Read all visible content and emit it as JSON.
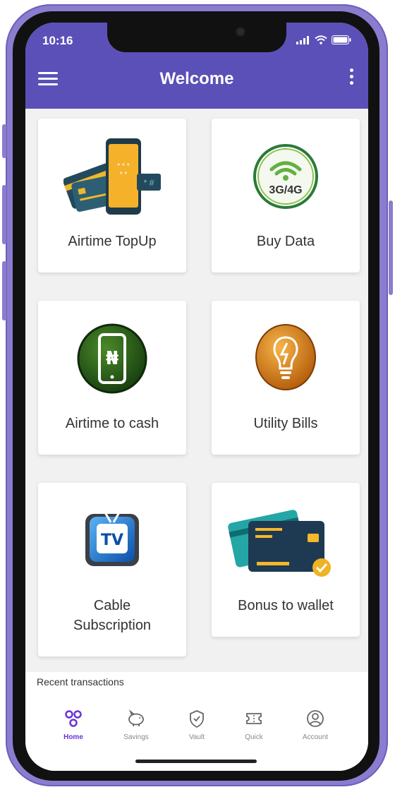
{
  "status_bar": {
    "time": "10:16"
  },
  "app_bar": {
    "title": "Welcome"
  },
  "tiles": [
    {
      "label": "Airtime TopUp",
      "icon": "airtime-topup-icon"
    },
    {
      "label": "Buy Data",
      "icon": "data-3g4g-icon",
      "badge": "3G/4G"
    },
    {
      "label": "Airtime to cash",
      "icon": "naira-phone-icon",
      "symbol": "₦"
    },
    {
      "label": "Utility Bills",
      "icon": "lightbulb-icon"
    },
    {
      "label": "Cable Subscription",
      "icon": "tv-icon",
      "badge": "TV"
    },
    {
      "label": "Bonus to wallet",
      "icon": "cards-icon"
    }
  ],
  "recent": {
    "label": "Recent transactions"
  },
  "bottom_nav": [
    {
      "label": "Home",
      "icon": "home-bubbles-icon",
      "active": true
    },
    {
      "label": "Savings",
      "icon": "piggy-bank-icon",
      "active": false
    },
    {
      "label": "Vault",
      "icon": "shield-check-icon",
      "active": false
    },
    {
      "label": "Quick",
      "icon": "ticket-icon",
      "active": false
    },
    {
      "label": "Account",
      "icon": "account-icon",
      "active": false
    }
  ],
  "colors": {
    "primary": "#5b50b8",
    "active_nav": "#6a34d6",
    "frame": "#8c7cd0"
  }
}
